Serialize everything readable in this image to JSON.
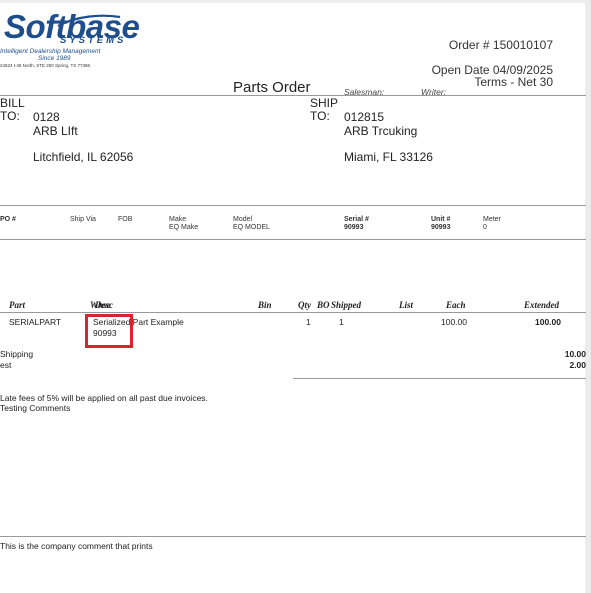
{
  "logo": {
    "wordmark": "Softbase",
    "systems": "SYSTEMS",
    "tagline": "Intelligent Dealership Management",
    "since": "Since 1989",
    "address": "24624 I-45 North, STE 250 Spring, TX 77386"
  },
  "header": {
    "order_number": "Order # 150010107",
    "open_date": "Open Date 04/09/2025",
    "terms": "Terms - Net 30",
    "title": "Parts Order",
    "salesman_label": "Salesman:",
    "writer_label": "Writer:"
  },
  "bill_to": {
    "label_line1": "BILL",
    "label_line2": "TO:",
    "account": "0128",
    "name": "ARB LIft",
    "city_line": "Litchfield, IL 62056"
  },
  "ship_to": {
    "label_line1": "SHIP",
    "label_line2": "TO:",
    "account": "012815",
    "name": "ARB Trcuking",
    "city_line": "Miami, FL 33126"
  },
  "info_row": {
    "po_label": "PO #",
    "ship_via_label": "Ship Via",
    "fob_label": "FOB",
    "make_label": "Make",
    "eq_make_label": "EQ Make",
    "model_label": "Model",
    "eq_model_label": "EQ MODEL",
    "serial_label": "Serial #",
    "serial_value": "90993",
    "unit_label": "Unit #",
    "unit_value": "90993",
    "meter_label": "Meter",
    "meter_value": "0"
  },
  "line_items": {
    "columns": {
      "part": "Part",
      "whse": "Whse",
      "desc": "Desc",
      "bin": "Bin",
      "qty": "Qty",
      "bo": "BO",
      "shipped": "Shipped",
      "list": "List",
      "each": "Each",
      "extended": "Extended"
    },
    "rows": [
      {
        "part": "SERIALPART",
        "desc": "Serialized Part Example",
        "serial": "90993",
        "qty": "1",
        "shipped": "1",
        "each": "100.00",
        "extended": "100.00"
      }
    ]
  },
  "charges": {
    "shipping_label": "Shipping",
    "shipping_value": "10.00",
    "test_label": "est",
    "test_value": "2.00"
  },
  "comments": {
    "line1": "Late fees of 5% will be applied on all past due invoices.",
    "line2": "Testing Comments",
    "company": "This is the company comment that prints"
  },
  "colors": {
    "logo_blue": "#1f4e8c",
    "highlight_red": "#d9232e"
  }
}
